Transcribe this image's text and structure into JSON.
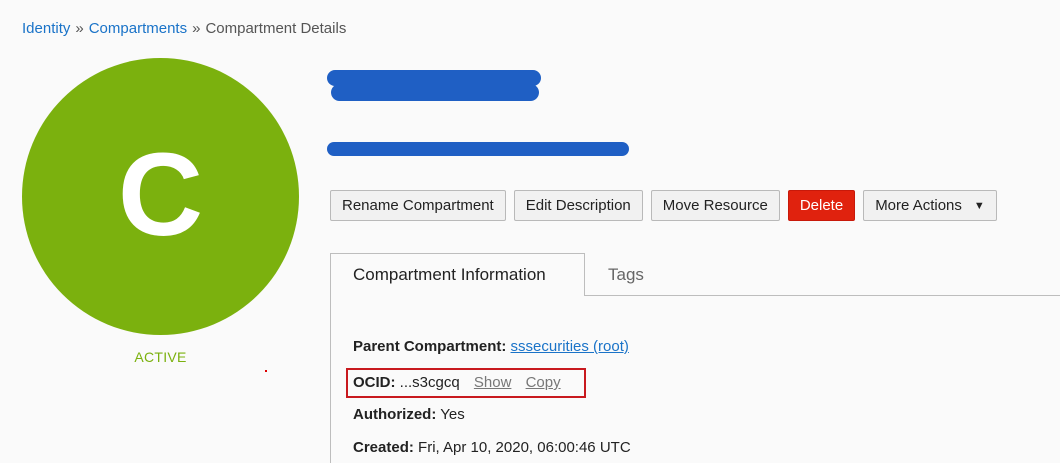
{
  "breadcrumb": {
    "items": [
      "Identity",
      "Compartments"
    ],
    "separator": "»",
    "current": "Compartment Details"
  },
  "avatar": {
    "letter": "C",
    "color": "#7bb10e"
  },
  "status": "ACTIVE",
  "actions": {
    "rename": "Rename Compartment",
    "edit_description": "Edit Description",
    "move_resource": "Move Resource",
    "delete": "Delete",
    "more_actions": "More Actions",
    "caret_icon": "▼"
  },
  "tabs": {
    "info": "Compartment Information",
    "tags": "Tags"
  },
  "details": {
    "parent_label": "Parent Compartment:",
    "parent_value": "sssecurities (root)",
    "ocid_label": "OCID:",
    "ocid_value": "...s3cgcq",
    "show_link": "Show",
    "copy_link": "Copy",
    "authorized_label": "Authorized:",
    "authorized_value": "Yes",
    "created_label": "Created:",
    "created_value": "Fri, Apr 10, 2020, 06:00:46 UTC"
  },
  "colors": {
    "link": "#1a73c8",
    "danger": "#e0220e",
    "redaction": "#1f5fc4",
    "highlight_box": "#c8191e"
  }
}
